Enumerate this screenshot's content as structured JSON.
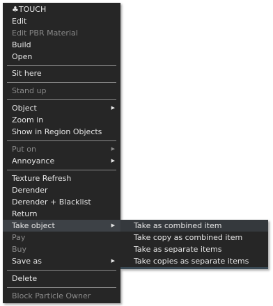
{
  "menu": {
    "items": [
      {
        "label": "♣TOUCH",
        "disabled": false,
        "submenu": false
      },
      {
        "label": "Edit",
        "disabled": false,
        "submenu": false
      },
      {
        "label": "Edit PBR Material",
        "disabled": true,
        "submenu": false
      },
      {
        "label": "Build",
        "disabled": false,
        "submenu": false
      },
      {
        "label": "Open",
        "disabled": false,
        "submenu": false
      },
      {
        "label": "Sit here",
        "disabled": false,
        "submenu": false
      },
      {
        "label": "Stand up",
        "disabled": true,
        "submenu": false
      },
      {
        "label": "Object",
        "disabled": false,
        "submenu": true
      },
      {
        "label": "Zoom in",
        "disabled": false,
        "submenu": false
      },
      {
        "label": "Show in Region Objects",
        "disabled": false,
        "submenu": false
      },
      {
        "label": "Put on",
        "disabled": true,
        "submenu": true
      },
      {
        "label": "Annoyance",
        "disabled": false,
        "submenu": true
      },
      {
        "label": "Texture Refresh",
        "disabled": false,
        "submenu": false
      },
      {
        "label": "Derender",
        "disabled": false,
        "submenu": false
      },
      {
        "label": "Derender + Blacklist",
        "disabled": false,
        "submenu": false
      },
      {
        "label": "Return",
        "disabled": false,
        "submenu": false
      },
      {
        "label": "Take object",
        "disabled": false,
        "submenu": true,
        "highlighted": true
      },
      {
        "label": "Pay",
        "disabled": true,
        "submenu": false
      },
      {
        "label": "Buy",
        "disabled": true,
        "submenu": false
      },
      {
        "label": "Save as",
        "disabled": false,
        "submenu": true
      },
      {
        "label": "Delete",
        "disabled": false,
        "submenu": false
      },
      {
        "label": "Block Particle Owner",
        "disabled": true,
        "submenu": false
      }
    ],
    "submenu_arrow": "▶"
  },
  "take_object_submenu": {
    "items": [
      {
        "label": "Take as combined item",
        "highlighted": true
      },
      {
        "label": "Take copy as combined item",
        "highlighted": false
      },
      {
        "label": "Take as separate items",
        "highlighted": false
      },
      {
        "label": "Take copies as separate items",
        "highlighted": false
      }
    ]
  },
  "colors": {
    "menu_background": "#262626",
    "text": "#e6e6e6",
    "disabled_text": "#8a8a8a",
    "highlight": "#3d4146",
    "separator": "#8c8c8c"
  }
}
